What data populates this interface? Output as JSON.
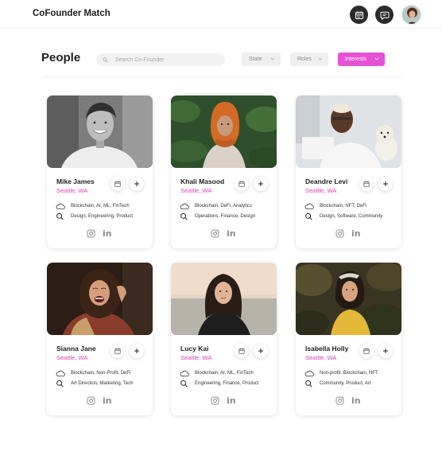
{
  "app": {
    "title": "CoFounder Match"
  },
  "header": {
    "icons": {
      "calendar": "calendar-icon",
      "messages": "chat-icon",
      "avatar": "user-avatar"
    }
  },
  "page": {
    "title": "People"
  },
  "search": {
    "placeholder": "Search Co-Founder",
    "value": ""
  },
  "filters": [
    {
      "label": "State",
      "active": false
    },
    {
      "label": "Roles",
      "active": false
    },
    {
      "label": "Interests",
      "active": true
    }
  ],
  "colors": {
    "accent": "#e552d4",
    "location": "#e13fb6",
    "dark_button": "#2b2b2b"
  },
  "people": [
    {
      "name": "Mike James",
      "location": "Seattle, WA",
      "tags": "Blockchain, AI, ML, FinTech",
      "roles": "Design, Engineering, Product"
    },
    {
      "name": "Khali Masood",
      "location": "Seattle, WA",
      "tags": "Blockchain, DeFi, Analytics",
      "roles": "Operations, Finance, Design"
    },
    {
      "name": "Deandre Levi",
      "location": "Seattle, WA",
      "tags": "Blockchain, NFT, DeFi",
      "roles": "Design, Software, Community"
    },
    {
      "name": "Sianna Jane",
      "location": "Seattle, WA",
      "tags": "Blockchain, Non-Profit, DeFi",
      "roles": "Art Direction, Marketing, Tech"
    },
    {
      "name": "Lucy Kai",
      "location": "Seattle, WA",
      "tags": "Blockchain, AI, ML, FinTech",
      "roles": "Engineering, Finance, Product"
    },
    {
      "name": "Isabella Holly",
      "location": "Seattle, WA",
      "tags": "Non-profit, Blockchain, NFT",
      "roles": "Community, Product, Art"
    }
  ],
  "social": {
    "instagram": "instagram-icon",
    "linkedin": "in"
  }
}
